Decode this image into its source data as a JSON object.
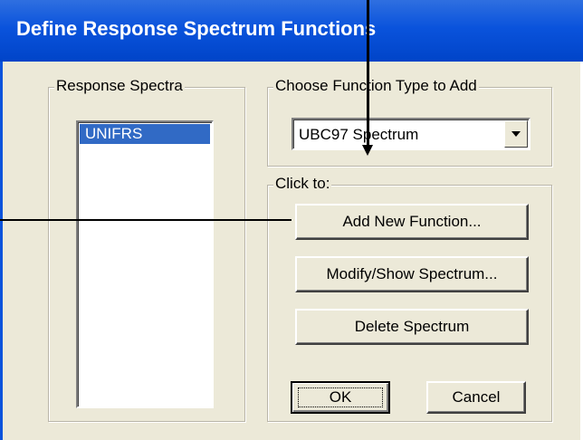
{
  "window": {
    "title": "Define Response Spectrum Functions"
  },
  "response_spectra": {
    "legend": "Response Spectra",
    "items": [
      "UNIFRS"
    ],
    "selected": "UNIFRS"
  },
  "function_type": {
    "legend": "Choose  Function Type to Add",
    "selected": "UBC97 Spectrum"
  },
  "click_to": {
    "legend": "Click to:",
    "add_label": "Add New Function...",
    "modify_label": "Modify/Show Spectrum...",
    "delete_label": "Delete Spectrum"
  },
  "footer": {
    "ok_label": "OK",
    "cancel_label": "Cancel"
  },
  "colors": {
    "titlebar": "#0a53dc",
    "selection": "#316ac5",
    "dialog_bg": "#ece9d8"
  }
}
